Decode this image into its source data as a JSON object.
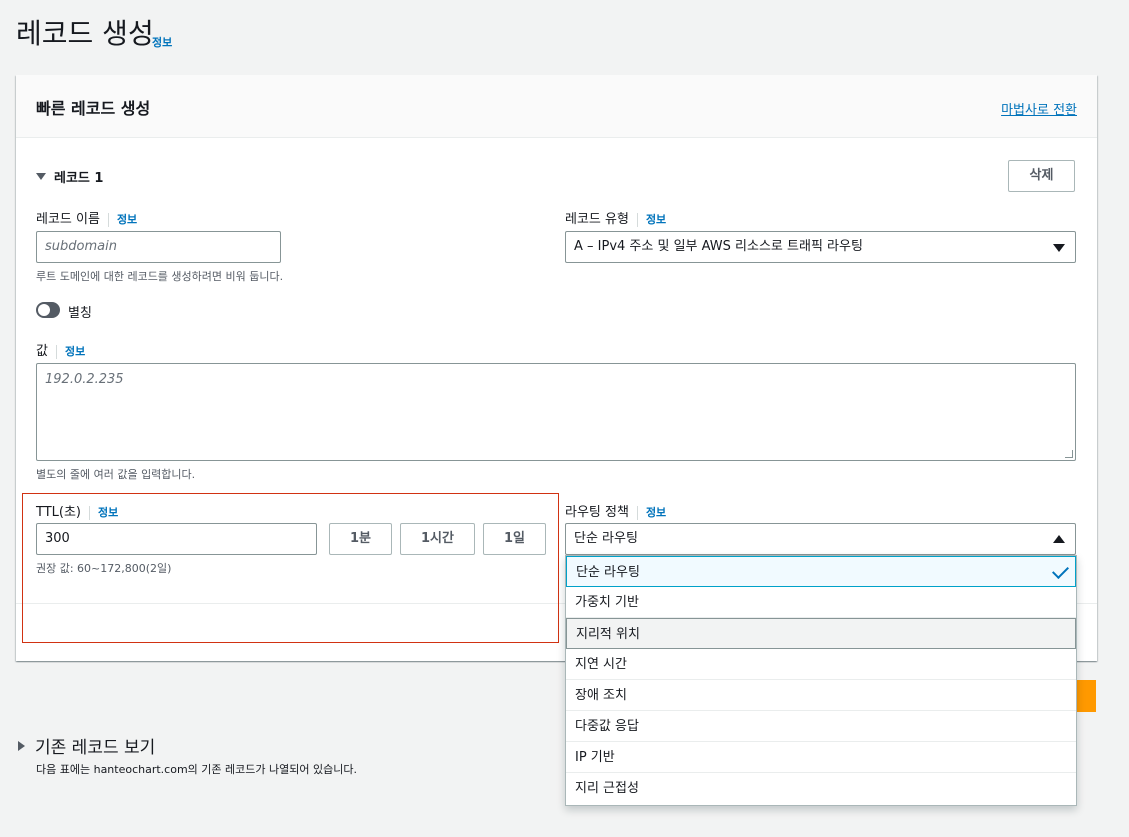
{
  "page": {
    "title": "레코드 생성",
    "info": "정보"
  },
  "card": {
    "title": "빠른 레코드 생성",
    "wizard_link": "마법사로 전환"
  },
  "record": {
    "header": "레코드 1",
    "delete_label": "삭제",
    "name": {
      "label": "레코드 이름",
      "info": "정보",
      "placeholder": "subdomain",
      "hint": "루트 도메인에 대한 레코드를 생성하려면 비워 둡니다."
    },
    "type": {
      "label": "레코드 유형",
      "info": "정보",
      "value": "A – IPv4 주소 및 일부 AWS 리소스로 트래픽 라우팅"
    },
    "alias": {
      "label": "별칭",
      "enabled": false
    },
    "value": {
      "label": "값",
      "info": "정보",
      "placeholder": "192.0.2.235",
      "hint": "별도의 줄에 여러 값을 입력합니다."
    },
    "ttl": {
      "label": "TTL(초)",
      "info": "정보",
      "value": "300",
      "btn_1m": "1분",
      "btn_1h": "1시간",
      "btn_1d": "1일",
      "hint": "권장 값: 60~172,800(2일)"
    },
    "routing": {
      "label": "라우팅 정책",
      "info": "정보",
      "value": "단순 라우팅",
      "options": [
        "단순 라우팅",
        "가중치 기반",
        "지리적 위치",
        "지연 시간",
        "장애 조치",
        "다중값 응답",
        "IP 기반",
        "지리 근접성"
      ]
    }
  },
  "existing": {
    "title": "기존 레코드 보기",
    "description": "다음 표에는 hanteochart.com의 기존 레코드가 나열되어 있습니다."
  },
  "colors": {
    "accent": "#0073bb",
    "highlight_border": "#d13212",
    "primary_button": "#ff9900"
  },
  "icons": {
    "expand_record": "caret-down-icon",
    "type_select": "caret-down-icon",
    "routing_select": "caret-up-icon",
    "selected": "check-icon",
    "existing_toggle": "caret-right-icon"
  }
}
